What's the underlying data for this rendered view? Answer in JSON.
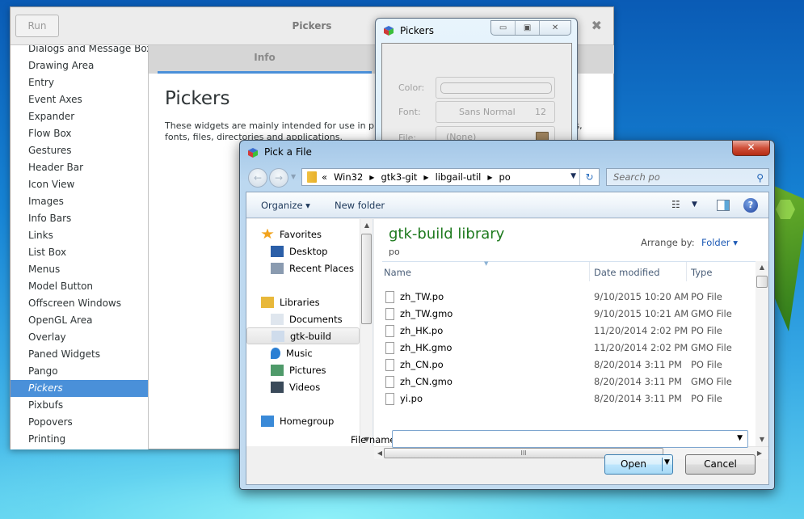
{
  "gtk_window": {
    "title": "Pickers",
    "run_label": "Run",
    "close_glyph": "✖",
    "sidebar_items": [
      {
        "label": "Dialogs and Message Boxes",
        "selected": false
      },
      {
        "label": "Drawing Area",
        "selected": false
      },
      {
        "label": "Entry",
        "selected": false
      },
      {
        "label": "Event Axes",
        "selected": false
      },
      {
        "label": "Expander",
        "selected": false
      },
      {
        "label": "Flow Box",
        "selected": false
      },
      {
        "label": "Gestures",
        "selected": false
      },
      {
        "label": "Header Bar",
        "selected": false
      },
      {
        "label": "Icon View",
        "selected": false
      },
      {
        "label": "Images",
        "selected": false
      },
      {
        "label": "Info Bars",
        "selected": false
      },
      {
        "label": "Links",
        "selected": false
      },
      {
        "label": "List Box",
        "selected": false
      },
      {
        "label": "Menus",
        "selected": false
      },
      {
        "label": "Model Button",
        "selected": false
      },
      {
        "label": "Offscreen Windows",
        "selected": false
      },
      {
        "label": "OpenGL Area",
        "selected": false
      },
      {
        "label": "Overlay",
        "selected": false
      },
      {
        "label": "Paned Widgets",
        "selected": false
      },
      {
        "label": "Pango",
        "selected": false
      },
      {
        "label": "Pickers",
        "selected": true
      },
      {
        "label": "Pixbufs",
        "selected": false
      },
      {
        "label": "Popovers",
        "selected": false
      },
      {
        "label": "Printing",
        "selected": false
      }
    ],
    "tab_label": "Info",
    "heading": "Pickers",
    "description": "These widgets are mainly intended for use in preferences dialogs. They allow to select colors, fonts, files, directories and applications."
  },
  "pickers_window": {
    "title": "Pickers",
    "controls": {
      "minimize": "▭",
      "maximize": "▣",
      "close": "✕"
    },
    "rows": [
      {
        "label": "Color:",
        "value": ""
      },
      {
        "label": "Font:",
        "value": "Sans Normal",
        "size": "12"
      },
      {
        "label": "File:",
        "value": "(None)"
      }
    ]
  },
  "file_dialog": {
    "title": "Pick a File",
    "close_glyph": "✕",
    "nav_back": "←",
    "nav_forward": "→",
    "breadcrumb_overflow": "«",
    "breadcrumb": [
      "Win32",
      "gtk3-git",
      "libgail-util",
      "po"
    ],
    "breadcrumb_sep": "▶",
    "refresh_glyph": "↻",
    "search_placeholder": "Search po",
    "search_glyph": "⚲",
    "toolbar": {
      "organize": "Organize ▾",
      "new_folder": "New folder",
      "views_glyph": "☷",
      "dropdown_glyph": "▼",
      "help_glyph": "?"
    },
    "nav_tree": [
      {
        "label": "Favorites",
        "icon": "star-icon",
        "indent": 0,
        "selected": false
      },
      {
        "label": "Desktop",
        "icon": "desktop-icon",
        "indent": 1,
        "selected": false
      },
      {
        "label": "Recent Places",
        "icon": "recent-places-icon",
        "indent": 1,
        "selected": false
      },
      {
        "label": "Libraries",
        "icon": "libraries-icon",
        "indent": 0,
        "selected": false
      },
      {
        "label": "Documents",
        "icon": "documents-icon",
        "indent": 1,
        "selected": false
      },
      {
        "label": "gtk-build",
        "icon": "library-icon",
        "indent": 1,
        "selected": true
      },
      {
        "label": "Music",
        "icon": "music-icon",
        "indent": 1,
        "selected": false
      },
      {
        "label": "Pictures",
        "icon": "pictures-icon",
        "indent": 1,
        "selected": false
      },
      {
        "label": "Videos",
        "icon": "videos-icon",
        "indent": 1,
        "selected": false
      },
      {
        "label": "Homegroup",
        "icon": "homegroup-icon",
        "indent": 0,
        "selected": false
      }
    ],
    "library_title": "gtk-build library",
    "library_subtitle": "po",
    "arrange_label": "Arrange by:",
    "arrange_value": "Folder ▾",
    "columns": [
      "Name",
      "Date modified",
      "Type"
    ],
    "files": [
      {
        "name": "zh_TW.po",
        "date": "9/10/2015 10:20 AM",
        "type": "PO File"
      },
      {
        "name": "zh_TW.gmo",
        "date": "9/10/2015 10:21 AM",
        "type": "GMO File"
      },
      {
        "name": "zh_HK.po",
        "date": "11/20/2014 2:02 PM",
        "type": "PO File"
      },
      {
        "name": "zh_HK.gmo",
        "date": "11/20/2014 2:02 PM",
        "type": "GMO File"
      },
      {
        "name": "zh_CN.po",
        "date": "8/20/2014 3:11 PM",
        "type": "PO File"
      },
      {
        "name": "zh_CN.gmo",
        "date": "8/20/2014 3:11 PM",
        "type": "GMO File"
      },
      {
        "name": "yi.po",
        "date": "8/20/2014 3:11 PM",
        "type": "PO File"
      }
    ],
    "file_name_label": "File name:",
    "file_name_value": "",
    "open_label": "Open",
    "cancel_label": "Cancel",
    "scroll_grip": "III",
    "arrow_up": "▲",
    "arrow_down": "▼",
    "arrow_left": "◀",
    "arrow_right": "▶"
  }
}
